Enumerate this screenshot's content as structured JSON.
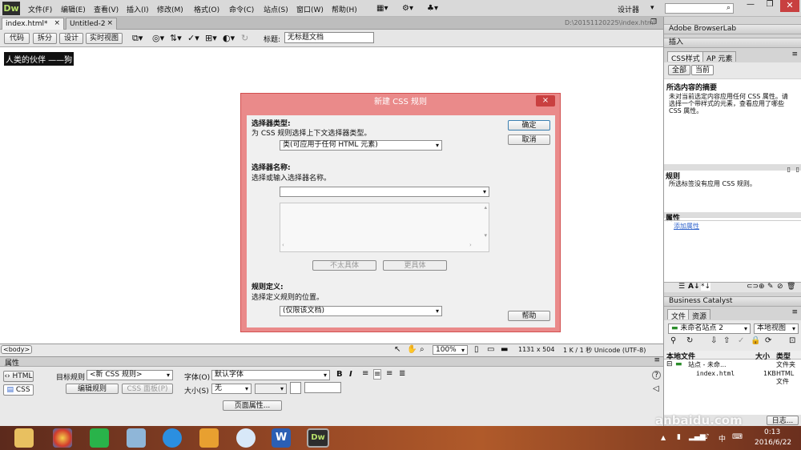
{
  "app": {
    "logo": "Dw",
    "workspace": "设计器",
    "search_placeholder": ""
  },
  "menu": [
    "文件(F)",
    "编辑(E)",
    "查看(V)",
    "插入(I)",
    "修改(M)",
    "格式(O)",
    "命令(C)",
    "站点(S)",
    "窗口(W)",
    "帮助(H)"
  ],
  "tabs": [
    {
      "label": "index.html*"
    },
    {
      "label": "Untitled-2"
    }
  ],
  "file_path": "D:\\20151120225\\index.html",
  "view_buttons": [
    "代码",
    "拆分",
    "设计",
    "实时视图"
  ],
  "title_label": "标题:",
  "title_value": "无标题文档",
  "design_text": "人类的伙伴 ——狗",
  "status": {
    "tag": "<body>",
    "zoom": "100%",
    "size": "1131 x 504",
    "file_info": "1 K / 1 秒 Unicode (UTF-8)"
  },
  "props_header": "属性",
  "props": {
    "html_btn": "HTML",
    "css_btn": "CSS",
    "target_rule_label": "目标规则",
    "target_rule_value": "<新 CSS 规则>",
    "edit_rule": "编辑规则",
    "css_panel": "CSS 面板(P)",
    "font_label": "字体(O)",
    "font_value": "默认字体",
    "size_label": "大小(S)",
    "size_value": "无",
    "page_props": "页面属性..."
  },
  "dialog": {
    "title": "新建 CSS 规则",
    "close": "×",
    "section1_title": "选择器类型:",
    "section1_desc": "为 CSS 规则选择上下文选择器类型。",
    "selector_type": "类(可应用于任何 HTML 元素)",
    "section2_title": "选择器名称:",
    "section2_desc": "选择或输入选择器名称。",
    "less_specific": "不太具体",
    "more_specific": "更具体",
    "section3_title": "规则定义:",
    "section3_desc": "选择定义规则的位置。",
    "rule_location": "(仅限该文档)",
    "ok": "确定",
    "cancel": "取消",
    "help": "帮助"
  },
  "right_panel": {
    "browserlab": "Adobe BrowserLab",
    "insert": "插入",
    "css_tab": "CSS样式",
    "ap_tab": "AP 元素",
    "all": "全部",
    "current": "当前",
    "summary_title": "所选内容的摘要",
    "summary_text": "未对当前选定内容应用任何 CSS 属性。请选择一个带样式的元素，查看应用了哪些 CSS 属性。",
    "rules_title": "规则",
    "rules_text": "所选标签没有应用 CSS 规则。",
    "properties_title": "属性",
    "add_property": "添加属性",
    "business_catalyst": "Business Catalyst",
    "files_tab": "文件",
    "assets_tab": "资源",
    "site_select": "未命名站点 2",
    "view_select": "本地视图",
    "col_local": "本地文件",
    "col_size": "大小",
    "col_type": "类型",
    "site_row": "站点 - 未命...",
    "site_row_type": "文件夹",
    "file_name": "index.html",
    "file_size": "1KB",
    "file_type": "HTML 文件",
    "log_btn": "日志..."
  },
  "taskbar": {
    "time": "0:13",
    "date": "2016/6/22",
    "ime": "中"
  },
  "watermark": "anbaidu.com"
}
